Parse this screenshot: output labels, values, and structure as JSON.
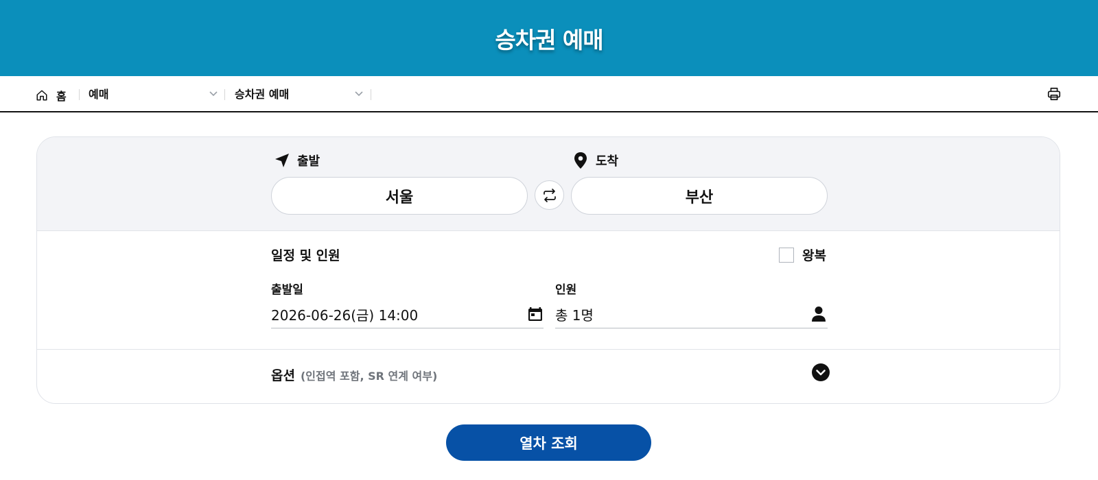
{
  "header": {
    "title": "승차권 예매"
  },
  "breadcrumb": {
    "home_label": "홈",
    "level1": "예매",
    "level2": "승차권 예매"
  },
  "route": {
    "departure_label": "출발",
    "arrival_label": "도착",
    "departure_station": "서울",
    "arrival_station": "부산"
  },
  "schedule": {
    "section_title": "일정 및 인원",
    "round_trip_label": "왕복",
    "round_trip_checked": false,
    "date_label": "출발일",
    "date_value": "2026-06-26(금) 14:00",
    "passengers_label": "인원",
    "passengers_value": "총 1명"
  },
  "options": {
    "title": "옵션",
    "subtitle": "(인접역 포함, SR 연계 여부)"
  },
  "search_button": "열차 조회",
  "colors": {
    "header_bg": "#0b8fbb",
    "primary_button": "#0751a6",
    "panel_bg": "#f3f4f7"
  },
  "icons": {
    "home": "home-icon",
    "print": "printer-icon",
    "departure": "navigation-arrow-icon",
    "arrival": "map-pin-icon",
    "swap": "swap-arrows-icon",
    "calendar": "calendar-icon",
    "person": "person-icon",
    "expand": "chevron-down-circle-icon"
  }
}
